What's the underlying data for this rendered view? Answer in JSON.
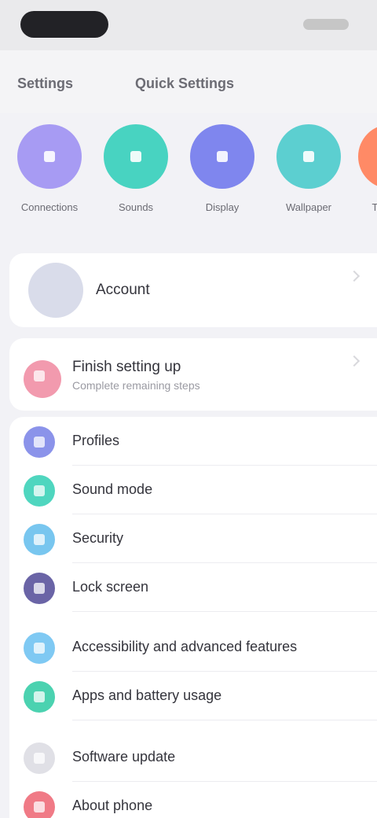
{
  "tabs": [
    {
      "label": "Settings"
    },
    {
      "label": "Quick Settings"
    }
  ],
  "shortcuts": [
    {
      "label": "Connections",
      "icon": "connections-icon",
      "color": "#a79bf3"
    },
    {
      "label": "Sounds",
      "icon": "sound-icon",
      "color": "#48d3c1"
    },
    {
      "label": "Display",
      "icon": "display-icon",
      "color": "#7f86ee"
    },
    {
      "label": "Wallpaper",
      "icon": "wallpaper-icon",
      "color": "#5ccfd0"
    },
    {
      "label": "Themes",
      "icon": "themes-icon",
      "color": "#ff8a66"
    }
  ],
  "profile": {
    "label": "Account"
  },
  "banner": {
    "title": "Finish setting up",
    "subtitle": "Complete remaining steps"
  },
  "menu": [
    {
      "label": "Profiles",
      "icon": "profile-icon",
      "color": "#8b93ea"
    },
    {
      "label": "Sound mode",
      "icon": "sound-mode-icon",
      "color": "#4fd6bf"
    },
    {
      "label": "Security",
      "icon": "security-icon",
      "color": "#78c6ef"
    },
    {
      "label": "Lock screen",
      "icon": "lock-screen-icon",
      "color": "#6a64a6"
    },
    {
      "label": "Accessibility and advanced features",
      "icon": "accessibility-icon",
      "color": "#7fc9f3"
    },
    {
      "label": "Apps and battery usage",
      "icon": "apps-icon",
      "color": "#4bd2b0"
    },
    {
      "label": "Software update",
      "icon": "update-icon",
      "color": "#e0e0e6"
    },
    {
      "label": "About phone",
      "icon": "about-icon",
      "color": "#f07a86"
    }
  ]
}
